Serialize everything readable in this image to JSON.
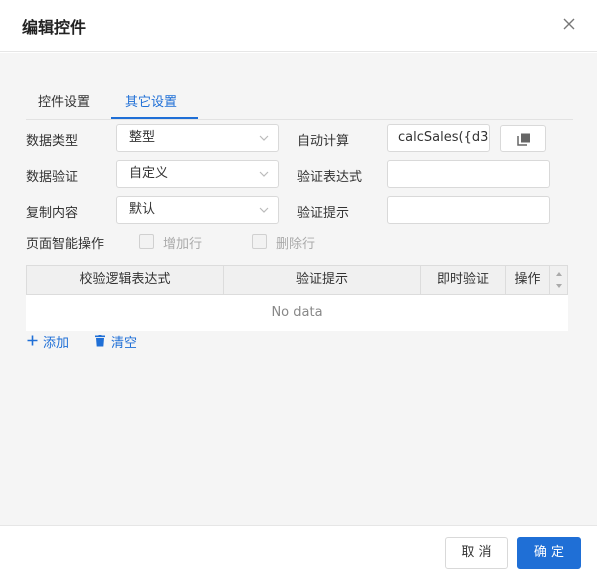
{
  "dialog": {
    "title": "编辑控件"
  },
  "tabs": [
    {
      "label": "控件设置",
      "active": false
    },
    {
      "label": "其它设置",
      "active": true
    }
  ],
  "form": {
    "data_type": {
      "label": "数据类型",
      "value": "整型"
    },
    "auto_calc": {
      "label": "自动计算",
      "value": "calcSales({d3"
    },
    "data_validation": {
      "label": "数据验证",
      "value": "自定义"
    },
    "validation_expr": {
      "label": "验证表达式",
      "value": ""
    },
    "copy_content": {
      "label": "复制内容",
      "value": "默认"
    },
    "validation_hint": {
      "label": "验证提示",
      "value": ""
    },
    "page_smart_ops": {
      "label": "页面智能操作",
      "add_row": "增加行",
      "delete_row": "删除行"
    }
  },
  "grid": {
    "columns": [
      "校验逻辑表达式",
      "验证提示",
      "即时验证",
      "操作"
    ],
    "empty_text": "No data"
  },
  "actions": {
    "add": "添加",
    "clear": "清空"
  },
  "footer": {
    "cancel": "取 消",
    "ok": "确 定"
  },
  "colors": {
    "accent": "#1f6fd6",
    "body_bg": "#f5f5f5"
  }
}
